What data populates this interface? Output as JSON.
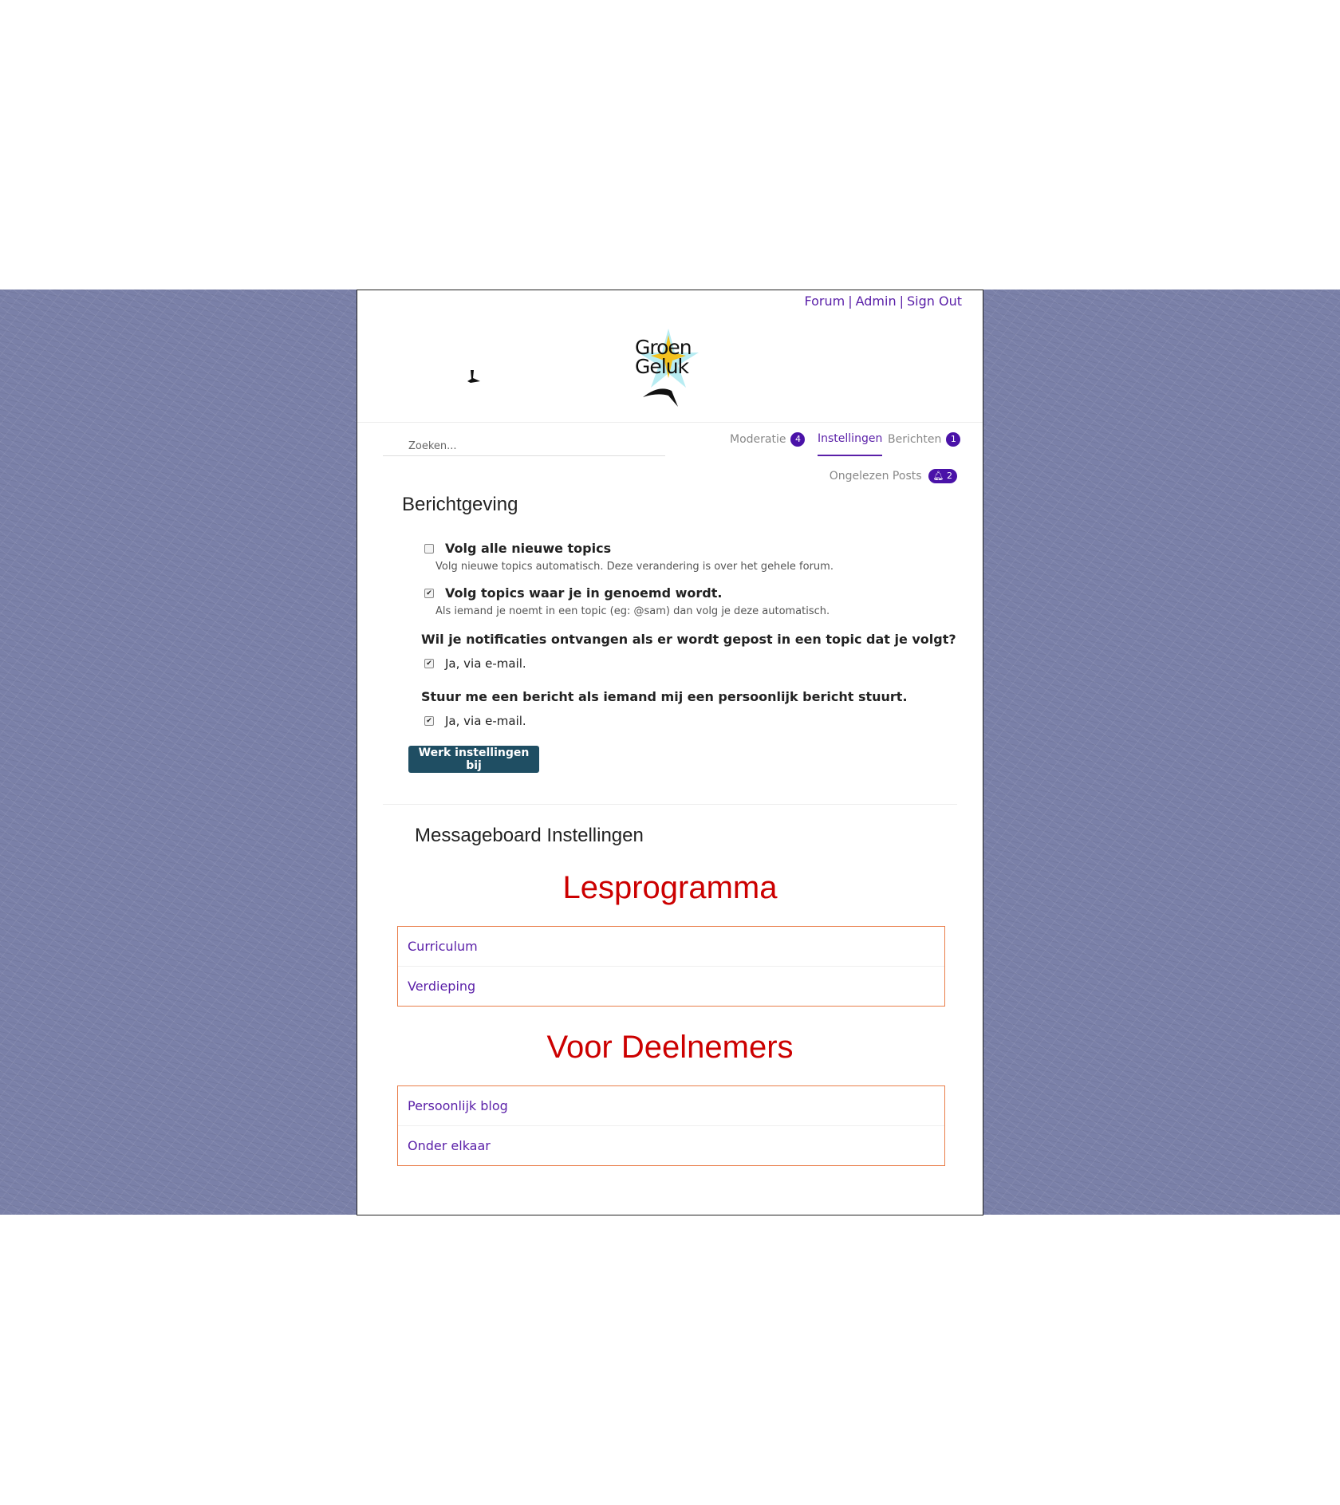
{
  "header": {
    "links": [
      "Forum",
      "Admin",
      "Sign Out"
    ],
    "logo_text_line1": "Groen",
    "logo_text_line2": "Geluk"
  },
  "nav": {
    "search_placeholder": "Zoeken...",
    "tabs": [
      {
        "label": "Moderatie",
        "badge": "4"
      },
      {
        "label": "Instellingen"
      },
      {
        "label": "Berichten",
        "badge": "1"
      }
    ],
    "unread_label": "Ongelezen Posts",
    "unread_count": "2"
  },
  "notifications": {
    "title": "Berichtgeving",
    "follow_all_label": "Volg alle nieuwe topics",
    "follow_all_help": "Volg nieuwe topics automatisch. Deze verandering is over het gehele forum.",
    "follow_all_checked": false,
    "follow_mentions_label": "Volg topics waar je in genoemd wordt.",
    "follow_mentions_help": "Als iemand je noemt in een topic (eg: @sam) dan volg je deze automatisch.",
    "follow_mentions_checked": true,
    "question_topic": "Wil je notificaties ontvangen als er wordt gepost in een topic dat je volgt?",
    "question_topic_answer": "Ja, via e-mail.",
    "question_pm": "Stuur me een bericht als iemand mij een persoonlijk bericht stuurt.",
    "question_pm_answer": "Ja, via e-mail.",
    "submit_label": "Werk instellingen bij"
  },
  "messageboard": {
    "title": "Messageboard Instellingen",
    "group1_title": "Lesprogramma",
    "group1_items": [
      "Curriculum",
      "Verdieping"
    ],
    "group2_title": "Voor Deelnemers",
    "group2_items": [
      "Persoonlijk blog",
      "Onder elkaar"
    ]
  },
  "colors": {
    "accent": "#5a1fa8",
    "button": "#1f4e63",
    "heading_red": "#cc0000",
    "box_border": "#e97e4a"
  }
}
